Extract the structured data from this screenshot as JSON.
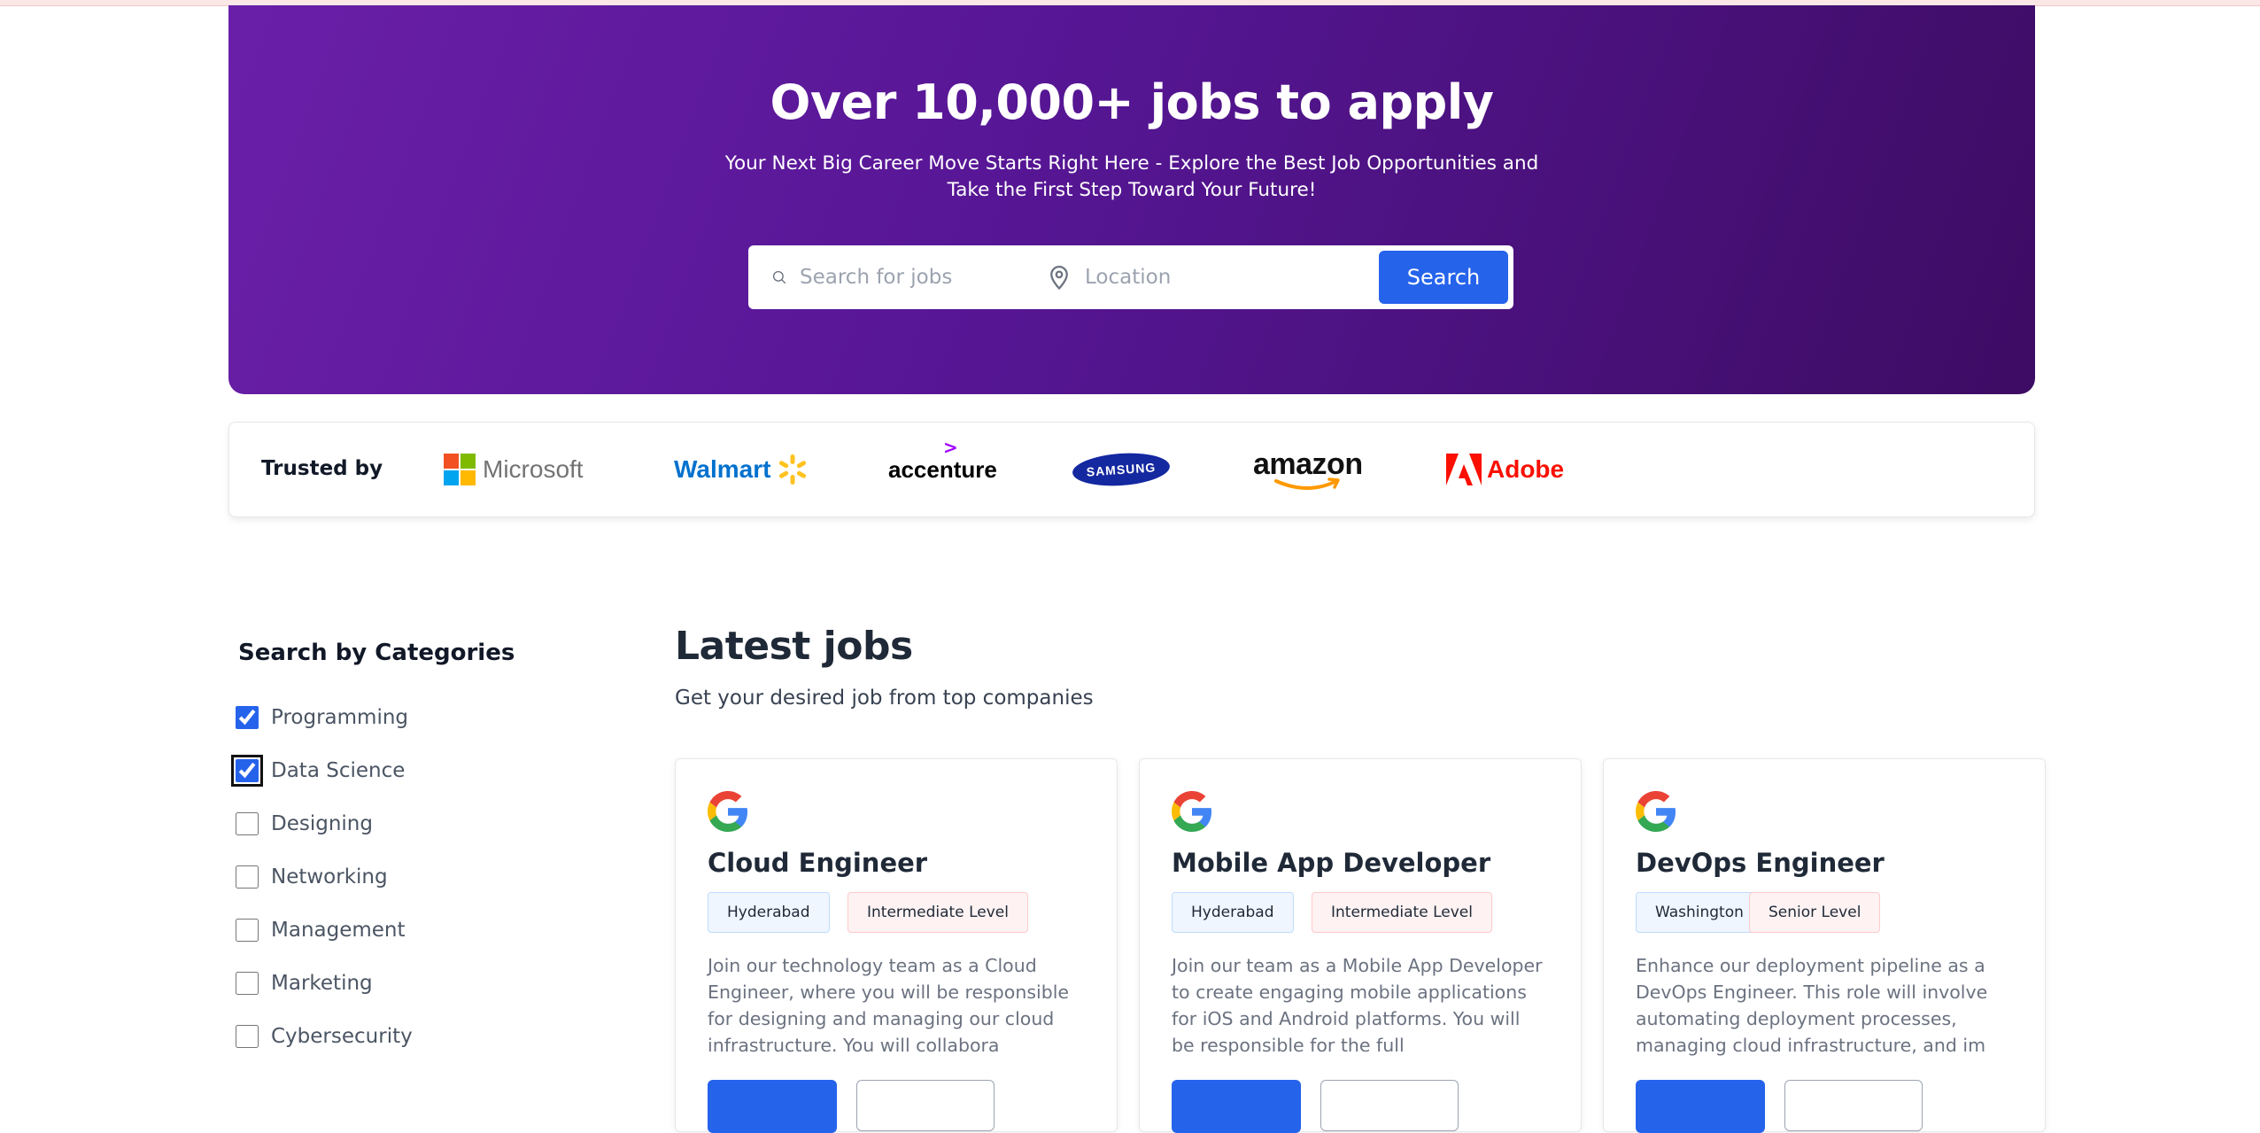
{
  "hero": {
    "title": "Over 10,000+ jobs to apply",
    "subtitle_line1": "Your Next Big Career Move Starts Right Here - Explore the Best Job Opportunities and",
    "subtitle_line2": "Take the First Step Toward Your Future!",
    "search": {
      "job_placeholder": "Search for jobs",
      "location_placeholder": "Location",
      "button_label": "Search"
    }
  },
  "trusted": {
    "label": "Trusted by",
    "companies": [
      "Microsoft",
      "Walmart",
      "accenture",
      "SAMSUNG",
      "amazon",
      "Adobe"
    ]
  },
  "categories": {
    "title": "Search by Categories",
    "items": [
      {
        "label": "Programming",
        "checked": true
      },
      {
        "label": "Data Science",
        "checked": true
      },
      {
        "label": "Designing",
        "checked": false
      },
      {
        "label": "Networking",
        "checked": false
      },
      {
        "label": "Management",
        "checked": false
      },
      {
        "label": "Marketing",
        "checked": false
      },
      {
        "label": "Cybersecurity",
        "checked": false
      }
    ]
  },
  "latest_jobs": {
    "title": "Latest jobs",
    "subtitle": "Get your desired job from top companies",
    "jobs": [
      {
        "title": "Cloud Engineer",
        "location": "Hyderabad",
        "level": "Intermediate Level",
        "description": "Join our technology team as a Cloud Engineer, where you will be responsible for designing and managing our cloud infrastructure. You will collabora"
      },
      {
        "title": "Mobile App Developer",
        "location": "Hyderabad",
        "level": "Intermediate Level",
        "description": "Join our team as a Mobile App Developer to create engaging mobile applications for iOS and Android platforms. You will be responsible for the full"
      },
      {
        "title": "DevOps Engineer",
        "location": "Washington",
        "level": "Senior Level",
        "description": "Enhance our deployment pipeline as a DevOps Engineer. This role will involve automating deployment processes, managing cloud infrastructure, and im"
      }
    ]
  },
  "colors": {
    "hero_gradient_start": "#6a1fa8",
    "hero_gradient_end": "#3d0c63",
    "primary_button": "#2563eb"
  }
}
